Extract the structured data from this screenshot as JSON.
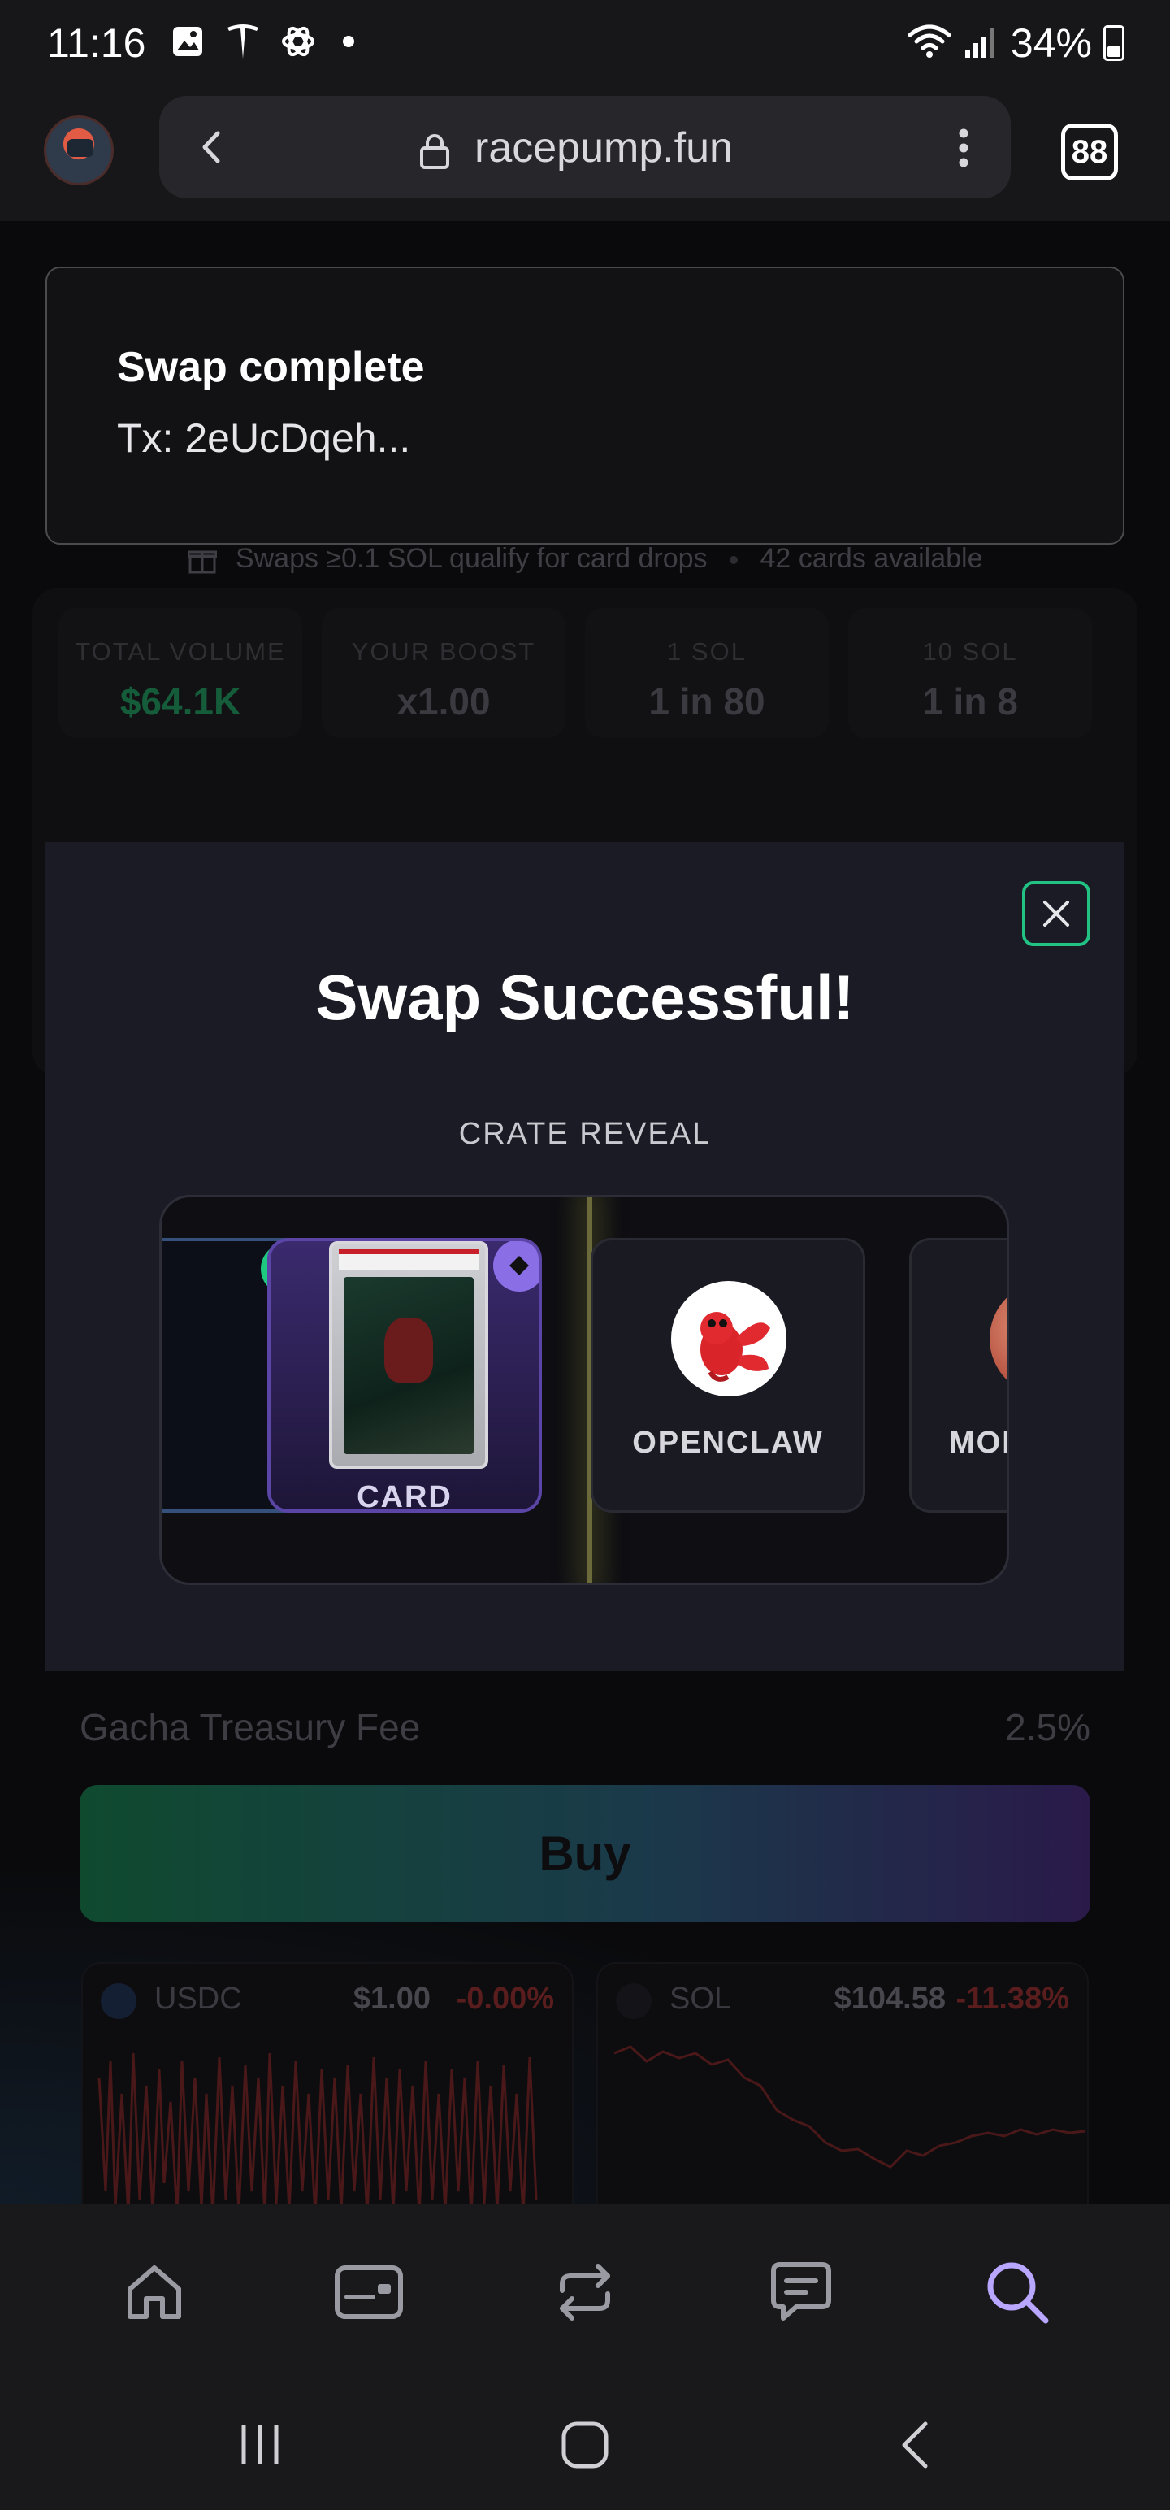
{
  "status_bar": {
    "time": "11:16",
    "battery": "34%",
    "icons": [
      "gallery-icon",
      "tesla-icon",
      "openai-icon",
      "dot-icon",
      "wifi-icon",
      "signal-icon",
      "battery-icon"
    ]
  },
  "browser": {
    "url": "racepump.fun",
    "tab_count": "88"
  },
  "toast": {
    "title": "Swap complete",
    "subtitle": "Tx: 2eUcDqeh..."
  },
  "background": {
    "drop_note_left": "Swaps ≥0.1 SOL qualify for card drops",
    "drop_note_right": "42 cards available",
    "stats": [
      {
        "label": "TOTAL VOLUME",
        "value": "$64.1K"
      },
      {
        "label": "YOUR BOOST",
        "value": "x1.00"
      },
      {
        "label": "1 SOL",
        "value": "1 in 80"
      },
      {
        "label": "10 SOL",
        "value": "1 in 8"
      }
    ],
    "fee_label": "Gacha Treasury Fee",
    "fee_value": "2.5%",
    "buy_label": "Buy",
    "tokens": [
      {
        "name": "USDC",
        "price": "$1.00",
        "change": "-0.00%"
      },
      {
        "name": "SOL",
        "price": "$104.58",
        "change": "-11.38%"
      }
    ]
  },
  "modal": {
    "title": "Swap Successful!",
    "subtitle": "CRATE REVEAL",
    "crates": [
      {
        "label": "",
        "badge": "star-icon"
      },
      {
        "label": "CARD",
        "badge": "diamond-icon"
      },
      {
        "label": "OPENCLAW",
        "badge": ""
      },
      {
        "label": "MOI",
        "badge": ""
      }
    ]
  },
  "colors": {
    "accent_green": "#22c184",
    "purple": "#8a6ee6",
    "nav_active": "#b9a6ff"
  }
}
